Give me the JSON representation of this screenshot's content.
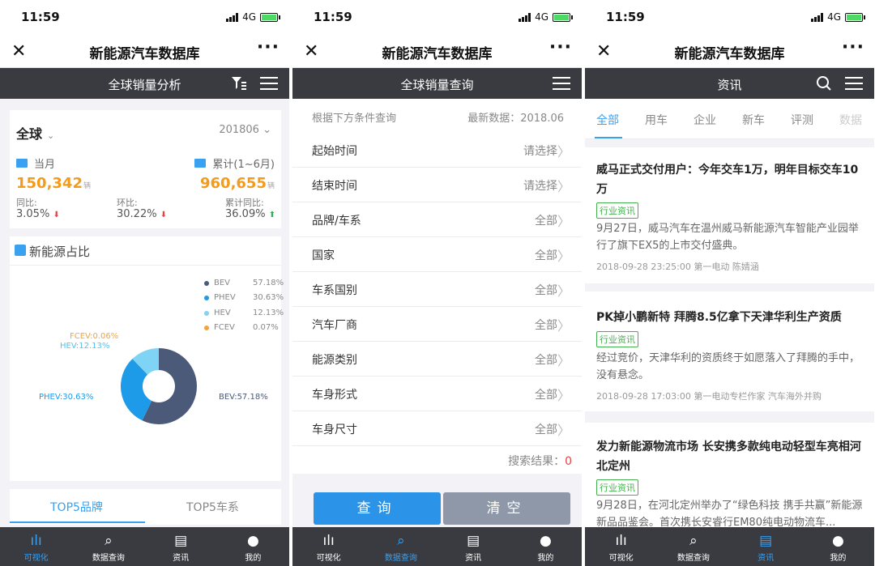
{
  "status": {
    "time": "11:59",
    "network": "4G"
  },
  "p1": {
    "nav_title": "新能源汽车数据库",
    "bar_title": "全球销量分析",
    "region": "全球",
    "period": "201806",
    "month_label": "当月",
    "cumulative_label": "累计(1~6月)",
    "month_value": "150,342",
    "cumulative_value": "960,655",
    "unit": "辆",
    "yoy_label": "同比:",
    "yoy_value": "3.05%",
    "mom_label": "环比:",
    "mom_value": "30.22%",
    "cum_yoy_label": "累计同比:",
    "cum_yoy_value": "36.09%",
    "share_title": "新能源占比",
    "legend": [
      {
        "name": "BEV",
        "pct": "57.18%",
        "color": "#4a5a78"
      },
      {
        "name": "PHEV",
        "pct": "30.63%",
        "color": "#1e9be8"
      },
      {
        "name": "HEV",
        "pct": "12.13%",
        "color": "#7fd3f5"
      },
      {
        "name": "FCEV",
        "pct": "0.07%",
        "color": "#f2a33c"
      }
    ],
    "pie_labels": {
      "fcev": "FCEV:0.06%",
      "hev": "HEV:12.13%",
      "phev": "PHEV:30.63%",
      "bev": "BEV:57.18%"
    },
    "chart_data": {
      "type": "pie",
      "categories": [
        "BEV",
        "PHEV",
        "HEV",
        "FCEV"
      ],
      "values": [
        57.18,
        30.63,
        12.13,
        0.07
      ]
    },
    "top_tabs": [
      "TOP5品牌",
      "TOP5车系"
    ]
  },
  "p2": {
    "nav_title": "新能源汽车数据库",
    "bar_title": "全球销量查询",
    "hint": "根据下方条件查询",
    "latest": "最新数据：2018.06",
    "rows": [
      {
        "label": "起始时间",
        "value": "请选择"
      },
      {
        "label": "结束时间",
        "value": "请选择"
      },
      {
        "label": "品牌/车系",
        "value": "全部"
      },
      {
        "label": "国家",
        "value": "全部"
      },
      {
        "label": "车系国别",
        "value": "全部"
      },
      {
        "label": "汽车厂商",
        "value": "全部"
      },
      {
        "label": "能源类别",
        "value": "全部"
      },
      {
        "label": "车身形式",
        "value": "全部"
      },
      {
        "label": "车身尺寸",
        "value": "全部"
      }
    ],
    "result_label": "搜索结果：",
    "result_value": "0",
    "query_btn": "查询",
    "clear_btn": "清空"
  },
  "p3": {
    "nav_title": "新能源汽车数据库",
    "bar_title": "资讯",
    "tabs": [
      "全部",
      "用车",
      "企业",
      "新车",
      "评测",
      "数据"
    ],
    "news": [
      {
        "title": "威马正式交付用户：今年交车1万，明年目标交车10万",
        "tag": "行业资讯",
        "summary": "9月27日，威马汽车在温州威马新能源汽车智能产业园举行了旗下EX5的上市交付盛典。",
        "meta": "2018-09-28 23:25:00 第一电动 陈婧涵"
      },
      {
        "title": "PK掉小鹏新特 拜腾8.5亿拿下天津华利生产资质",
        "tag": "行业资讯",
        "summary": "经过竞价，天津华利的资质终于如愿落入了拜腾的手中，没有悬念。",
        "meta": "2018-09-28 17:03:00 第一电动专栏作家 汽车海外并购"
      },
      {
        "title": "发力新能源物流市场 长安携多款纯电动轻型车亮相河北定州",
        "tag": "行业资讯",
        "summary": "9月28日，在河北定州举办了“绿色科技 携手共赢”新能源新品品鉴会。首次携长安睿行EM80纯电动物流车..."
      }
    ]
  },
  "tabbar": [
    "可视化",
    "数据查询",
    "资讯",
    "我的"
  ],
  "colors": {
    "accent": "#3aa0f0",
    "dark": "#393b40",
    "orange": "#f29b1d",
    "green": "#42b24c"
  }
}
